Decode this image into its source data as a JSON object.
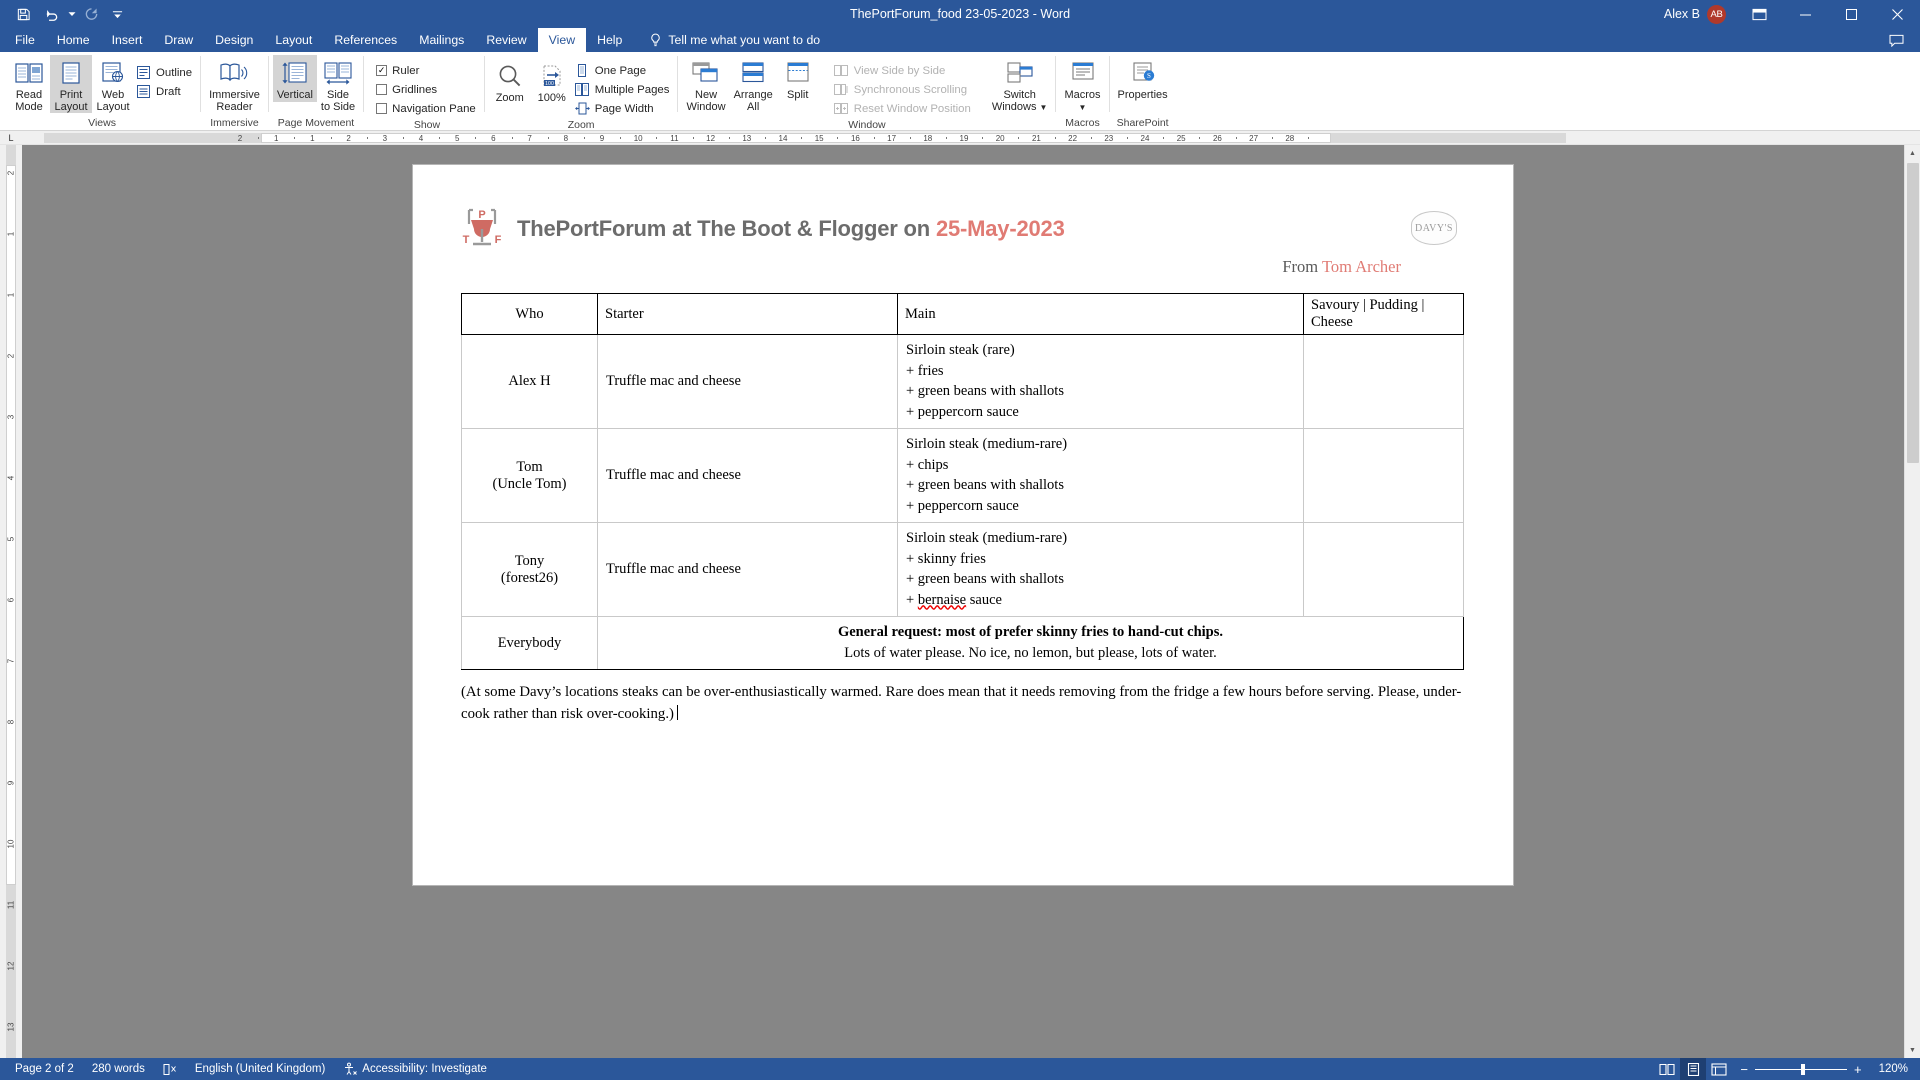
{
  "titlebar": {
    "document_name": "ThePortForum_food 23-05-2023",
    "separator": "-",
    "app_name": "Word",
    "quick_access": [
      {
        "name": "save",
        "icon": "save-icon"
      },
      {
        "name": "undo",
        "icon": "undo-icon"
      },
      {
        "name": "redo",
        "icon": "redo-icon"
      },
      {
        "name": "customize",
        "icon": "chevron-down-icon"
      }
    ],
    "account_name": "Alex B",
    "avatar_initials": "AB",
    "ribbon_display_icon": "ribbon-display-options-icon",
    "minimize": "–",
    "maximize": "☐",
    "close": "✕",
    "comments_icon": "comments-icon"
  },
  "tabs": [
    {
      "label": "File",
      "active": false
    },
    {
      "label": "Home",
      "active": false
    },
    {
      "label": "Insert",
      "active": false
    },
    {
      "label": "Draw",
      "active": false
    },
    {
      "label": "Design",
      "active": false
    },
    {
      "label": "Layout",
      "active": false
    },
    {
      "label": "References",
      "active": false
    },
    {
      "label": "Mailings",
      "active": false
    },
    {
      "label": "Review",
      "active": false
    },
    {
      "label": "View",
      "active": true
    },
    {
      "label": "Help",
      "active": false
    }
  ],
  "tellme": {
    "icon": "lightbulb-icon",
    "text": "Tell me what you want to do"
  },
  "ribbon": {
    "groups": [
      {
        "label": "Views",
        "buttons": [
          {
            "name": "read-mode",
            "line1": "Read",
            "line2": "Mode",
            "selected": false
          },
          {
            "name": "print-layout",
            "line1": "Print",
            "line2": "Layout",
            "selected": true
          },
          {
            "name": "web-layout",
            "line1": "Web",
            "line2": "Layout",
            "selected": false
          }
        ],
        "checks": [
          {
            "name": "outline",
            "label": "Outline"
          },
          {
            "name": "draft",
            "label": "Draft"
          }
        ]
      },
      {
        "label": "Immersive",
        "buttons": [
          {
            "name": "immersive-reader",
            "line1": "Immersive",
            "line2": "Reader",
            "selected": false
          }
        ]
      },
      {
        "label": "Page Movement",
        "buttons": [
          {
            "name": "vertical",
            "line1": "Vertical",
            "line2": "",
            "selected": true
          },
          {
            "name": "side-to-side",
            "line1": "Side",
            "line2": "to Side",
            "selected": false
          }
        ]
      },
      {
        "label": "Show",
        "checkboxes": [
          {
            "name": "ruler",
            "label": "Ruler",
            "checked": true
          },
          {
            "name": "gridlines",
            "label": "Gridlines",
            "checked": false
          },
          {
            "name": "navigation-pane",
            "label": "Navigation Pane",
            "checked": false
          }
        ]
      },
      {
        "label": "Zoom",
        "buttons": [
          {
            "name": "zoom",
            "line1": "Zoom",
            "line2": "",
            "selected": false
          },
          {
            "name": "zoom-100",
            "line1": "100%",
            "line2": "",
            "selected": false
          }
        ],
        "items": [
          {
            "name": "one-page",
            "label": "One Page"
          },
          {
            "name": "multiple-pages",
            "label": "Multiple Pages"
          },
          {
            "name": "page-width",
            "label": "Page Width"
          }
        ]
      },
      {
        "label": "Window",
        "buttons": [
          {
            "name": "new-window",
            "line1": "New",
            "line2": "Window",
            "selected": false
          },
          {
            "name": "arrange-all",
            "line1": "Arrange",
            "line2": "All",
            "selected": false
          },
          {
            "name": "split",
            "line1": "Split",
            "line2": "",
            "selected": false
          }
        ],
        "items": [
          {
            "name": "view-side-by-side",
            "label": "View Side by Side",
            "disabled": true
          },
          {
            "name": "synchronous-scrolling",
            "label": "Synchronous Scrolling",
            "disabled": true
          },
          {
            "name": "reset-window-position",
            "label": "Reset Window Position",
            "disabled": true
          }
        ],
        "buttons2": [
          {
            "name": "switch-windows",
            "line1": "Switch",
            "line2": "Windows",
            "selected": false
          }
        ]
      },
      {
        "label": "Macros",
        "buttons": [
          {
            "name": "macros",
            "line1": "Macros",
            "line2": "",
            "selected": false
          }
        ]
      },
      {
        "label": "SharePoint",
        "buttons": [
          {
            "name": "properties",
            "line1": "Properties",
            "line2": "",
            "selected": false
          }
        ]
      }
    ]
  },
  "ruler": {
    "corner_label": "L",
    "h_ticks": [
      "2",
      "1",
      "1",
      "2",
      "3",
      "4",
      "5",
      "6",
      "7",
      "8",
      "9",
      "10",
      "11",
      "12",
      "13",
      "14",
      "15",
      "16",
      "17",
      "18",
      "19",
      "20",
      "21",
      "22",
      "23",
      "24",
      "25",
      "26",
      "27",
      "28"
    ],
    "v_ticks": [
      "2",
      "1",
      "1",
      "2",
      "3",
      "4",
      "5",
      "6",
      "7",
      "8",
      "9",
      "10",
      "11",
      "12",
      "13"
    ]
  },
  "document": {
    "title_main": "ThePortForum at The Boot & Flogger on ",
    "title_date": "25-May-2023",
    "from_prefix": "From ",
    "from_name": "Tom Archer",
    "logo_letters": {
      "p": "P",
      "t": "T",
      "f": "F"
    },
    "brand_badge": "DAVY'S",
    "accent_color": "#e07b74",
    "title_color": "#6c6c6c",
    "table": {
      "headers": [
        "Who",
        "Starter",
        "Main",
        "Savoury | Pudding | Cheese"
      ],
      "rows": [
        {
          "who_line1": "Alex H",
          "who_line2": "",
          "starter": "Truffle mac and cheese",
          "main": [
            "Sirloin steak (rare)",
            "+ fries",
            "+ green beans with shallots",
            "+ peppercorn sauce"
          ],
          "end": ""
        },
        {
          "who_line1": "Tom",
          "who_line2": "(Uncle Tom)",
          "starter": "Truffle mac and cheese",
          "main": [
            "Sirloin steak (medium-rare)",
            "+ chips",
            "+ green beans with shallots",
            "+ peppercorn sauce"
          ],
          "end": ""
        },
        {
          "who_line1": "Tony",
          "who_line2": "(forest26)",
          "starter": "Truffle mac and cheese",
          "main": [
            "Sirloin steak (medium-rare)",
            "+ skinny fries",
            "+ green beans with shallots",
            "+ bernaise sauce"
          ],
          "main_misspelled_index": 3,
          "main_misspelled_word": "bernaise",
          "end": ""
        }
      ],
      "footer_row": {
        "who": "Everybody",
        "line1": "General request: most of prefer skinny fries to hand-cut chips.",
        "line2": "Lots of water please. No ice, no lemon, but please, lots of water."
      }
    },
    "footnote_line1": "(At some Davy’s locations steaks can be over-enthusiastically warmed. Rare does mean that it needs removing from the fridge a few hours before serving.",
    "footnote_line2": "Please, under-cook rather than risk over-cooking.)"
  },
  "status": {
    "page": "Page 2 of 2",
    "words": "280 words",
    "proofing_icon": "proofing-errors-icon",
    "language": "English (United Kingdom)",
    "accessibility_icon": "accessibility-icon",
    "accessibility": "Accessibility: Investigate",
    "view_buttons": [
      {
        "name": "read-mode-view",
        "icon": "read-mode-icon",
        "selected": false
      },
      {
        "name": "print-layout-view",
        "icon": "print-layout-icon",
        "selected": true
      },
      {
        "name": "web-layout-view",
        "icon": "web-layout-icon",
        "selected": false
      }
    ],
    "zoom_out": "−",
    "zoom_in": "+",
    "zoom_level": "120%"
  }
}
